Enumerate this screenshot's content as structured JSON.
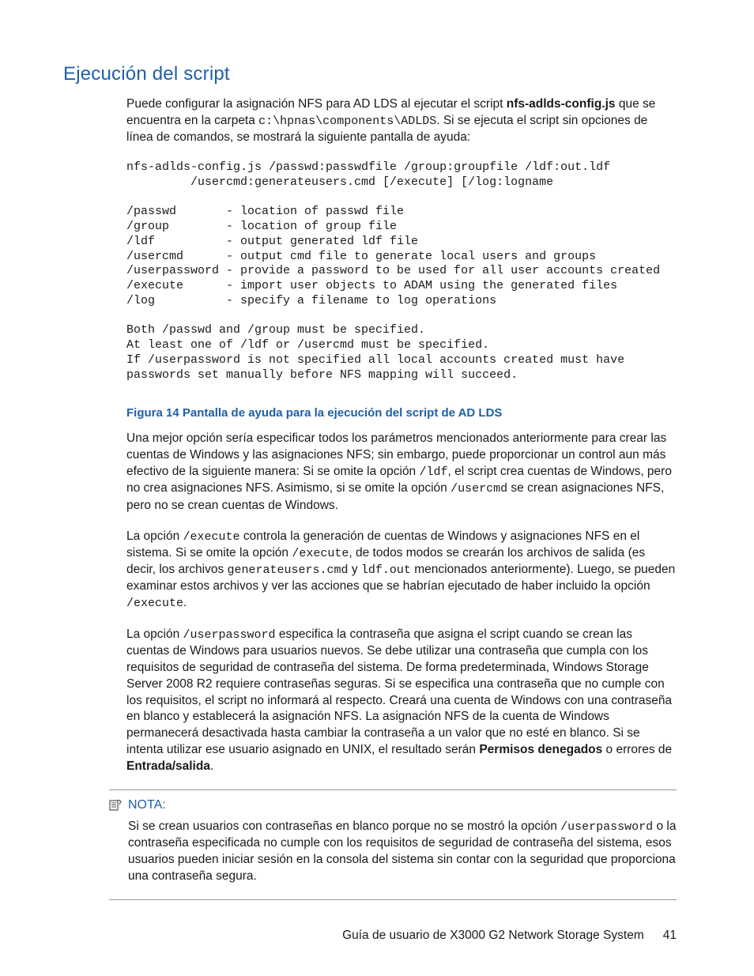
{
  "section_title": "Ejecución del script",
  "intro": {
    "part1": "Puede configurar la asignación NFS para AD LDS al ejecutar el script ",
    "scriptname": "nfs-adlds-config.js",
    "part2": " que se encuentra en la carpeta ",
    "path": "c:\\hpnas\\components\\ADLDS",
    "part3": ". Si se ejecuta el script sin opciones de línea de comandos, se mostrará la siguiente pantalla de ayuda:"
  },
  "codeblock": "nfs-adlds-config.js /passwd:passwdfile /group:groupfile /ldf:out.ldf\n         /usercmd:generateusers.cmd [/execute] [/log:logname\n\n/passwd       - location of passwd file\n/group        - location of group file\n/ldf          - output generated ldf file\n/usercmd      - output cmd file to generate local users and groups\n/userpassword - provide a password to be used for all user accounts created\n/execute      - import user objects to ADAM using the generated files\n/log          - specify a filename to log operations\n\nBoth /passwd and /group must be specified.\nAt least one of /ldf or /usercmd must be specified.\nIf /userpassword is not specified all local accounts created must have\npasswords set manually before NFS mapping will succeed.",
  "figure_caption": "Figura 14 Pantalla de ayuda para la ejecución del script de AD LDS",
  "para1": {
    "a": "Una mejor opción sería especificar todos los parámetros mencionados anteriormente para crear las cuentas de Windows y las asignaciones NFS; sin embargo, puede proporcionar un control aun más efectivo de la siguiente manera: Si se omite la opción ",
    "code1": "/ldf",
    "b": ", el script crea cuentas de Windows, pero no crea asignaciones NFS. Asimismo, si se omite la opción ",
    "code2": "/usercmd",
    "c": " se crean asignaciones NFS, pero no se crean cuentas de Windows."
  },
  "para2": {
    "a": "La opción ",
    "code1": "/execute",
    "b": " controla la generación de cuentas de Windows y asignaciones NFS en el sistema. Si se omite la opción ",
    "code2": "/execute",
    "c": ", de todos modos se crearán los archivos de salida (es decir, los archivos ",
    "code3": "generateusers.cmd",
    "d": " y ",
    "code4": "ldf.out",
    "e": " mencionados anteriormente). Luego, se pueden examinar estos archivos y ver las acciones que se habrían ejecutado de haber incluido la opción ",
    "code5": "/execute",
    "f": "."
  },
  "para3": {
    "a": "La opción ",
    "code1": "/userpassword",
    "b": " especifica la contraseña que asigna el script cuando se crean las cuentas de Windows para usuarios nuevos. Se debe utilizar una contraseña que cumpla con los requisitos de seguridad de contraseña del sistema. De forma predeterminada, Windows Storage Server 2008 R2 requiere contraseñas seguras. Si se especifica una contraseña que no cumple con los requisitos, el script no informará al respecto. Creará una cuenta de Windows con una contraseña en blanco y establecerá la asignación NFS. La asignación NFS de la cuenta de Windows permanecerá desactivada hasta cambiar la contraseña a un valor que no esté en blanco. Si se intenta utilizar ese usuario asignado en UNIX, el resultado serán ",
    "bold1": "Permisos denegados",
    "c": " o errores de ",
    "bold2": "Entrada/salida",
    "d": "."
  },
  "note": {
    "label": "NOTA:",
    "body_a": "Si se crean usuarios con contraseñas en blanco porque no se mostró la opción ",
    "body_code": "/userpassword",
    "body_b": " o la contraseña especificada no cumple con los requisitos de seguridad de contraseña del sistema, esos usuarios pueden iniciar sesión en la consola del sistema sin contar con la seguridad que proporciona una contraseña segura."
  },
  "footer": {
    "title": "Guía de usuario de X3000 G2 Network Storage System",
    "page": "41"
  }
}
